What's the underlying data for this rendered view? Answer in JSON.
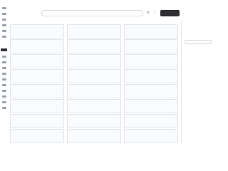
{
  "app": {
    "title": ""
  },
  "search": {
    "placeholder": "",
    "value": ""
  },
  "toolbar": {
    "primary_label": "",
    "icons": [
      "settings-icon",
      "more-icon"
    ]
  },
  "cards": [
    {
      "title": "",
      "tag": "",
      "description": ""
    },
    {
      "title": "",
      "tag": "",
      "description": ""
    },
    {
      "title": "",
      "tag": "",
      "description": ""
    },
    {
      "title": "",
      "tag": "",
      "description": ""
    },
    {
      "title": "",
      "tag": "",
      "description": ""
    },
    {
      "title": "",
      "tag": "",
      "description": ""
    },
    {
      "title": "",
      "tag": "",
      "description": ""
    },
    {
      "title": "",
      "tag": "",
      "description": ""
    },
    {
      "title": "",
      "tag": "",
      "description": ""
    },
    {
      "title": "",
      "tag": "",
      "description": ""
    },
    {
      "title": "",
      "tag": "",
      "description": ""
    },
    {
      "title": "",
      "tag": "",
      "description": ""
    },
    {
      "title": "",
      "tag": "",
      "description": ""
    },
    {
      "title": "",
      "tag": "",
      "description": ""
    },
    {
      "title": "",
      "tag": "",
      "description": ""
    },
    {
      "title": "",
      "tag": "",
      "description": ""
    },
    {
      "title": "",
      "tag": "",
      "description": ""
    },
    {
      "title": "",
      "tag": "",
      "description": ""
    },
    {
      "title": "",
      "tag": "",
      "description": ""
    },
    {
      "title": "",
      "tag": "",
      "description": ""
    },
    {
      "title": "",
      "tag": "",
      "description": ""
    },
    {
      "title": "",
      "tag": "",
      "description": ""
    },
    {
      "title": "",
      "tag": "",
      "description": ""
    },
    {
      "title": "",
      "tag": "",
      "description": ""
    }
  ],
  "detail": {
    "label": "",
    "field_value": "",
    "body": ""
  },
  "colors": {
    "primary_button": "#2e2f33",
    "card_border": "#e3e6ea",
    "page_bg": "#ffffff"
  }
}
